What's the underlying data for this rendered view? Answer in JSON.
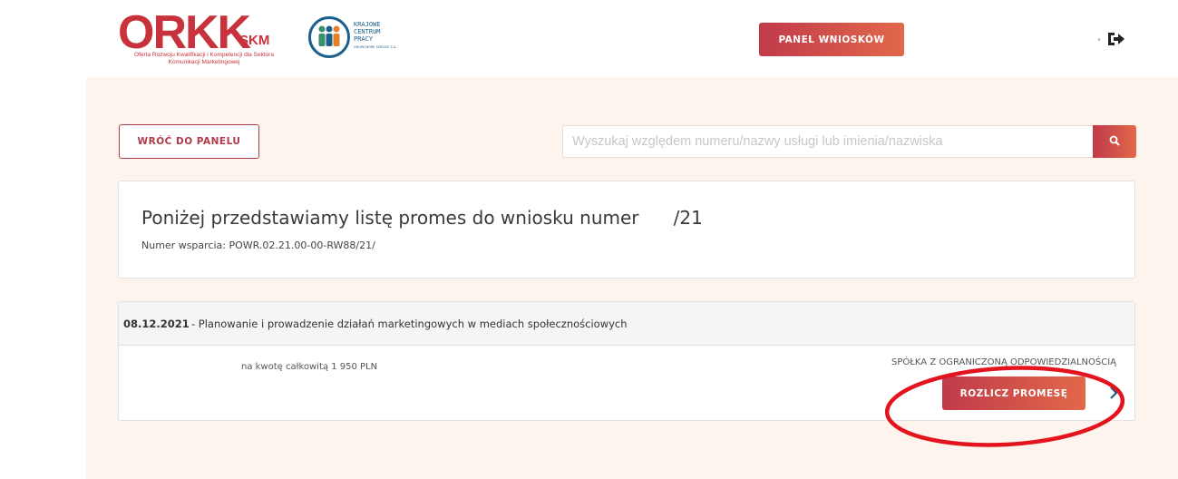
{
  "header": {
    "logo_orkk": {
      "word": "ORKK",
      "suffix": "SKM",
      "subtitle": "Oferta Rozwoju Kwalifikacji i Kompetencji dla Sektora Komunikacji Marketingowej"
    },
    "logo_kcp": {
      "text": "KRAJOWE\nCENTRUM\nPRACY",
      "small": "GRUPA MORE SERVICE S.A."
    },
    "panel_button_label": "PANEL WNIOSKÓW",
    "logout_icon": "sign-out-icon"
  },
  "toolbar": {
    "back_button_label": "WRÓĆ DO PANELU",
    "search_placeholder": "Wyszukaj względem numeru/nazwy usługi lub imienia/nazwiska",
    "search_value": "",
    "search_icon": "search-icon"
  },
  "info": {
    "title": "Poniżej przedstawiamy listę promes do wniosku numer      /21",
    "support_number": "Numer wsparcia: POWR.02.21.00-00-RW88/21/"
  },
  "promise": {
    "date": "08.12.2021",
    "name": "- Planowanie i prowadzenie działań marketingowych w mediach społecznościowych",
    "amount": "na kwotę całkowitą 1 950 PLN",
    "company": "SPÓŁKA Z OGRANICZONĄ ODPOWIEDZIALNOŚCIĄ",
    "settle_button_label": "ROZLICZ PROMESĘ",
    "details_icon": "chevron-right-icon"
  },
  "colors": {
    "brand_red": "#c13a4a",
    "brand_orange": "#e2684a",
    "background_beige": "#fdf5ed",
    "annotation_red": "#e3141e"
  }
}
